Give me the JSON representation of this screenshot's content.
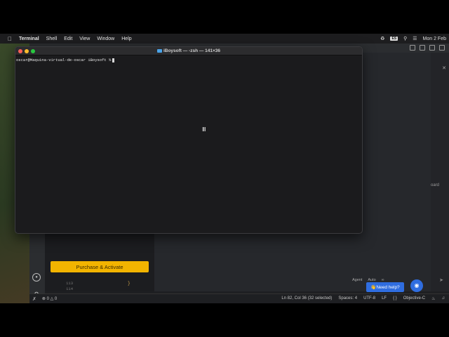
{
  "menubar": {
    "app": "Terminal",
    "items": [
      "Shell",
      "Edit",
      "View",
      "Window",
      "Help"
    ],
    "input_badge": "ES",
    "clock": "Mon 2 Feb"
  },
  "terminal": {
    "title": "iBoysoft — -zsh — 141×36",
    "prompt": "oscar@Maquina-virtual-de-oscar iBoysoft %"
  },
  "ide": {
    "purchase_label": "Purchase & Activate",
    "help_label": "👋Need help?",
    "gutter_lines": [
      "113",
      "114"
    ],
    "brace": "}",
    "right_clip": "oard",
    "agent": {
      "mode": "Agent",
      "model": "Auto"
    },
    "status_left": {
      "errors": "0",
      "warnings": "0"
    },
    "status": {
      "position": "Ln 82, Col 36 (32 selected)",
      "spaces": "Spaces: 4",
      "encoding": "UTF-8",
      "eol": "LF",
      "braces": "{ }",
      "language": "Objective-C"
    }
  }
}
